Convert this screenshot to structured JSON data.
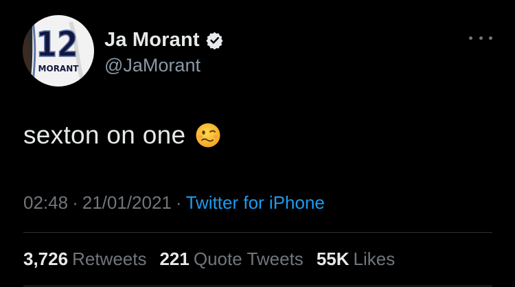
{
  "author": {
    "display_name": "Ja Morant",
    "handle": "@JaMorant",
    "avatar_jersey_number": "12",
    "avatar_jersey_name": "MORANT"
  },
  "icons": {
    "verified": "verified-badge-icon",
    "more": "more-options-icon",
    "emoji": "woozy-face-emoji"
  },
  "tweet": {
    "text": "sexton on one",
    "time": "02:48",
    "date": "21/01/2021",
    "separator": "·",
    "source": "Twitter for iPhone"
  },
  "stats": {
    "retweets_count": "3,726",
    "retweets_label": "Retweets",
    "quotes_count": "221",
    "quotes_label": "Quote Tweets",
    "likes_count": "55K",
    "likes_label": "Likes"
  },
  "colors": {
    "background": "#000000",
    "primary_text": "#e7e9ea",
    "secondary_text": "#71767b",
    "link": "#1d9bf0",
    "divider": "#2f3336"
  }
}
